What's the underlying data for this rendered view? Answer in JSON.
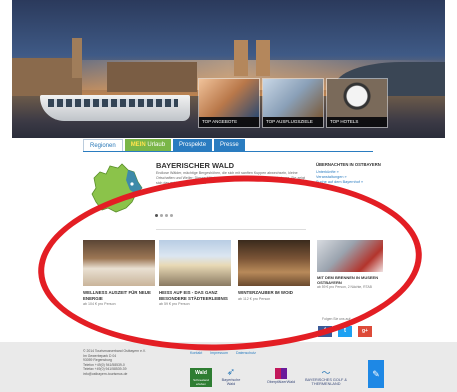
{
  "hero": {
    "thumbs": [
      {
        "caption": "TOP ANGEBOTE"
      },
      {
        "caption": "TOP AUSFLUGSZIELE"
      },
      {
        "caption": "TOP HOTELS"
      }
    ]
  },
  "nav": {
    "tabs": [
      {
        "label": "Regionen"
      },
      {
        "label_prefix": "MEIN",
        "label": " Urlaub"
      },
      {
        "label": "Prospekte"
      },
      {
        "label": "Presse"
      }
    ]
  },
  "intro": {
    "title": "BAYERISCHER WALD",
    "text": "Endlose Wälder, mächtige Bergeshöhen, die sich mit sanften Kuppen abwechseln, kleine Ortschaften und Weiler: Dieses Mittelgebirge im Osten Bayerns ist eine Entdeckung, Sie zeigt sich das größte Waldlandschaft"
  },
  "sidebar": {
    "title": "ÜBERNACHTEN IN OSTBAYERN",
    "links": [
      "Unterkünfte »",
      "Veranstaltungen »",
      "Suche auf dem Bayernhof »"
    ],
    "news_title": "MIT DEM BRENNEN IN MUSEEN OSTBAYERN",
    "news_sub": "ab 59 € pro Person, 2 Nächte, RTAB",
    "social_caption": "Folgen Sie uns auf:",
    "social": [
      {
        "icon": "facebook-icon",
        "glyph": "f"
      },
      {
        "icon": "twitter-icon",
        "glyph": "t"
      },
      {
        "icon": "google-plus-icon",
        "glyph": "g+"
      }
    ]
  },
  "cards": [
    {
      "title": "WELLNESS AUSZEIT FÜR NEUE ENERGIE",
      "price": "ab 104 € pro Person"
    },
    {
      "title": "HEISS AUF EIS - DAS GANZ BESONDERE STÄDTEERLEBNIS",
      "price": "ab 59 € pro Person"
    },
    {
      "title": "WINTERZAUBER IM WOID",
      "price": "ab 112 € pro Person"
    }
  ],
  "footer": {
    "address": [
      "© 2014 Tourismusverband Ostbayern e.V.",
      "Im Gewerbepark D 04",
      "93059 Regensburg",
      "Telefon +49(0) 941/58539-0",
      "Telefax +49(0) 941/58539-39",
      "info@ostbayern-tourismus.de"
    ],
    "links": [
      "Kontakt",
      "Impressum",
      "Datenschutz"
    ],
    "logos": {
      "wald": {
        "name": "Wald",
        "sub": "Schneeland erleben"
      },
      "bay": "Bayerische Wald",
      "obp": "OberpfälzerWald",
      "golf": "BAYERISCHES GOLF & THERMENLAND"
    }
  },
  "colors": {
    "accent": "#2a7cc0",
    "green_tab": "#7ab648",
    "annotation_red": "#e31e24"
  }
}
